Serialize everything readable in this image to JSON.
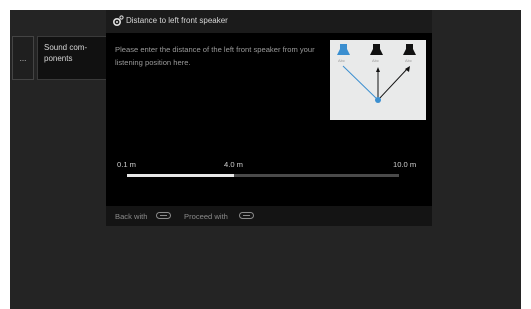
{
  "menu": {
    "stub_label": "...",
    "item_line1": "Sound com-",
    "item_line2": "ponents"
  },
  "dialog": {
    "title": "Distance to left front speaker",
    "instruction": "Please enter the distance of the left front speaker from your listening position here.",
    "diagram": {
      "speaker_labels": [
        "Abc",
        "Abc",
        "Abc"
      ],
      "highlight_color": "#3b8fd0",
      "icons": [
        "speaker-icon",
        "speaker-icon",
        "speaker-icon",
        "listener-dot-icon"
      ]
    },
    "slider": {
      "ticks": [
        "0.1 m",
        "4.0 m",
        "10.0 m"
      ],
      "value": "4.0 m",
      "min": 0.1,
      "max": 10.0,
      "current": 4.0
    },
    "footer": {
      "back_label": "Back with",
      "proceed_label": "Proceed with"
    }
  },
  "colors": {
    "accent": "#3b8fd0",
    "background": "#242424",
    "dialog": "#000000"
  }
}
